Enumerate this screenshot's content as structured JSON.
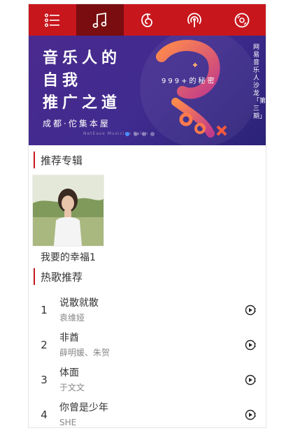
{
  "nav": {
    "items": [
      {
        "icon": "menu-icon"
      },
      {
        "icon": "music-note-icon",
        "active": true
      },
      {
        "icon": "netease-logo-icon"
      },
      {
        "icon": "radio-icon"
      },
      {
        "icon": "vinyl-record-icon"
      }
    ],
    "bg_color": "#c8161d",
    "active_color": "#7a0d0f"
  },
  "banner": {
    "title_line1": "音乐人的",
    "title_line2": "自我",
    "title_line3": "推广之道",
    "place": "成都·佗集本屋",
    "place_en": "NetEase Musician Salon",
    "tag": "999+的秘密",
    "side_text": "网易音乐人沙龙「第三期」"
  },
  "albums_section": {
    "title": "推荐专辑",
    "items": [
      {
        "name": "我要的幸福1"
      }
    ]
  },
  "songs_section": {
    "title": "热歌推荐",
    "items": [
      {
        "index": "1",
        "title": "说散就散",
        "artist": "袁维娅"
      },
      {
        "index": "2",
        "title": "非酋",
        "artist": "薛明媛、朱贺"
      },
      {
        "index": "3",
        "title": "体面",
        "artist": "于文文"
      },
      {
        "index": "4",
        "title": "你曾是少年",
        "artist": "SHE"
      }
    ]
  }
}
